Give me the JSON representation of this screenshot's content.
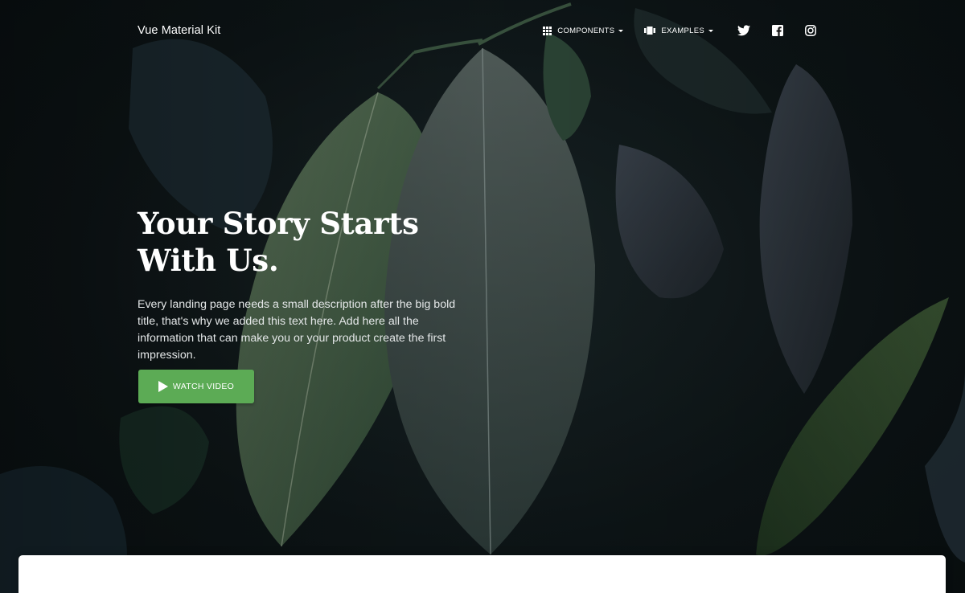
{
  "brand": "Vue Material Kit",
  "nav": {
    "components": {
      "label": "Components",
      "icon": "apps-grid-icon"
    },
    "examples": {
      "label": "Examples",
      "icon": "view-carousel-icon"
    },
    "social": [
      {
        "name": "twitter-icon"
      },
      {
        "name": "facebook-icon"
      },
      {
        "name": "instagram-icon"
      }
    ]
  },
  "hero": {
    "title_line1": "Your Story Starts",
    "title_line2": "With Us.",
    "description": "Every landing page needs a small description after the big bold title, that's why we added this text here. Add here all the information that can make you or your product create the first impression.",
    "watch_button": {
      "label": "Watch Video",
      "icon": "play-icon"
    }
  },
  "colors": {
    "accent": "#5cab55",
    "background": "#0f1719"
  }
}
